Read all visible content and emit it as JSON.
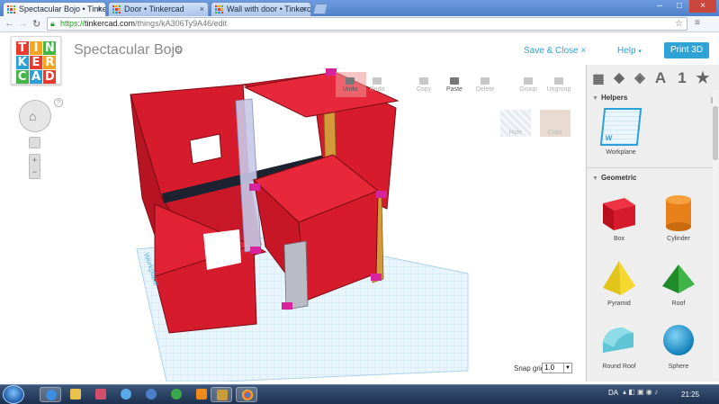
{
  "browser": {
    "tabs": [
      {
        "title": "Spectacular Bojo • Tinkerca",
        "active": true
      },
      {
        "title": "Door • Tinkercad",
        "active": false
      },
      {
        "title": "Wall with door • Tinkercad",
        "active": false
      }
    ],
    "url_scheme": "https://",
    "url_host": "tinkercad.com",
    "url_path": "/things/kA306Ty9A46/edit"
  },
  "app": {
    "logo_letters": [
      "T",
      "I",
      "N",
      "K",
      "E",
      "R",
      "C",
      "A",
      "D"
    ],
    "logo_colors": [
      "#e63b2e",
      "#f4a623",
      "#45b649",
      "#2aa0d8",
      "#e63b2e",
      "#f4a623",
      "#45b649",
      "#2aa0d8",
      "#e63b2e"
    ],
    "design_title": "Spectacular Bojo",
    "save_close": "Save & Close",
    "help": "Help",
    "print": "Print 3D"
  },
  "toolbar": {
    "undo": "Undo",
    "redo": "Redo",
    "copy": "Copy",
    "paste": "Paste",
    "delete": "Delete",
    "group": "Group",
    "ungroup": "Ungroup",
    "hole": "Hole",
    "color": "Color"
  },
  "viewport": {
    "workplane_label": "Workplane",
    "snap_grid_label": "Snap grid",
    "snap_grid_value": "1.0"
  },
  "panel": {
    "tab_letter": "A",
    "tab_number": "1",
    "helpers_title": "Helpers",
    "workplane_item": "Workplane",
    "geometric_title": "Geometric",
    "shapes": [
      "Box",
      "Cylinder",
      "Pyramid",
      "Roof",
      "Round Roof",
      "Sphere"
    ]
  },
  "taskbar": {
    "lang": "DA",
    "clock": "21:25"
  },
  "colors": {
    "wall_red": "#dd1f2f",
    "accent_blue": "#2aa0d8",
    "grid_blue": "#cfe8f5"
  }
}
